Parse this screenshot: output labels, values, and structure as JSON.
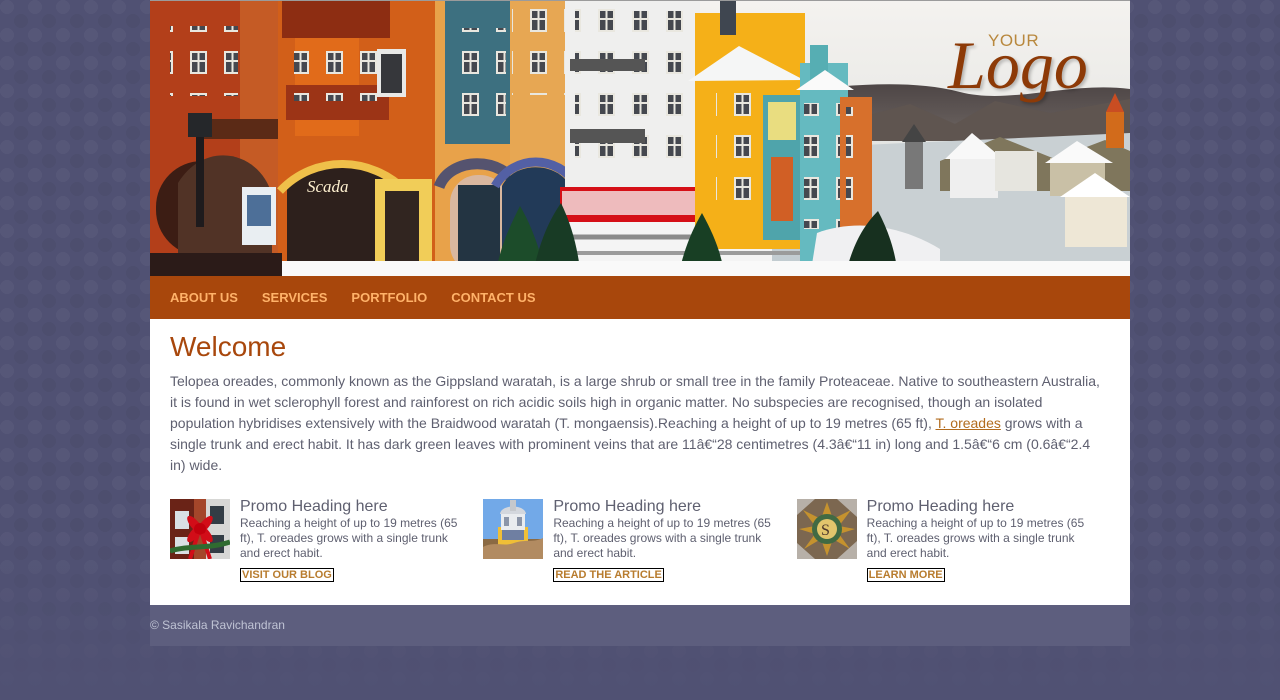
{
  "header": {
    "logo_small": "YOUR",
    "logo_main": "Logo"
  },
  "navigation": {
    "items": [
      {
        "label": "ABOUT US"
      },
      {
        "label": "SERVICES"
      },
      {
        "label": "PORTFOLIO"
      },
      {
        "label": "CONTACT US"
      }
    ]
  },
  "main": {
    "title": "Welcome",
    "intro_part1": "Telopea oreades, commonly known as the Gippsland waratah, is a large shrub or small tree in the family Proteaceae. Native to southeastern Australia, it is found in wet sclerophyll forest and rainforest on rich acidic soils high in organic matter. No subspecies are recognised, though an isolated population hybridises extensively with the Braidwood waratah (T. mongaensis).Reaching a height of up to 19 metres (65 ft), ",
    "intro_link": "T. oreades",
    "intro_part2": " grows with a single trunk and erect habit. It has dark green leaves with prominent veins that are 11â€“28 centimetres (4.3â€“11 in) long and 1.5â€“6 cm (0.6â€“2.4 in) wide."
  },
  "promos": [
    {
      "heading": "Promo Heading here",
      "body": "Reaching a height of up to 19 metres (65 ft), T. oreades grows with a single trunk and erect habit.",
      "button": "VISIT OUR BLOG"
    },
    {
      "heading": "Promo Heading here",
      "body": "Reaching a height of up to 19 metres (65 ft), T. oreades grows with a single trunk and erect habit.",
      "button": "READ THE ARTICLE"
    },
    {
      "heading": "Promo Heading here",
      "body": "Reaching a height of up to 19 metres (65 ft), T. oreades grows with a single trunk and erect habit.",
      "button": "LEARN MORE"
    }
  ],
  "footer": {
    "text": "© Sasikala Ravichandran"
  },
  "colors": {
    "page_background": "#505173",
    "nav_background": "#a8470c",
    "nav_text": "#ffb269",
    "heading": "#a8470c",
    "body_text": "#5f6070",
    "link": "#b26b1d",
    "footer_background": "#5d5e7e"
  }
}
